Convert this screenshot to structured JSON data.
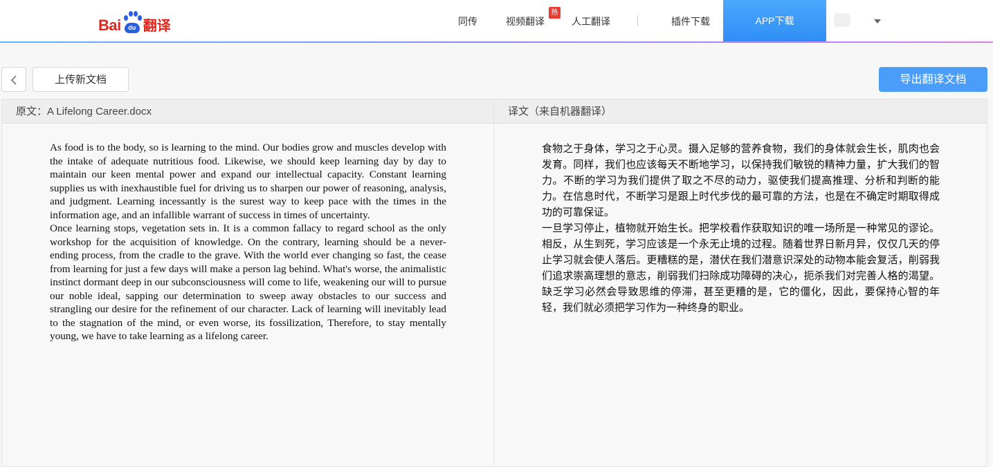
{
  "header": {
    "logo": {
      "bai": "Bai",
      "du": "du",
      "fanyi": "翻译"
    },
    "nav": [
      {
        "label": "同传"
      },
      {
        "label": "视频翻译",
        "badge": "热"
      },
      {
        "label": "人工翻译"
      },
      {
        "label": "插件下载"
      }
    ],
    "app_download": "APP下载"
  },
  "toolbar": {
    "upload_label": "上传新文档",
    "export_label": "导出翻译文档"
  },
  "source_panel": {
    "header_prefix": "原文：",
    "file_name": "A Lifelong Career.docx",
    "paragraphs": [
      "As food is to the body, so is learning to the mind. Our bodies grow and muscles develop with the intake of adequate nutritious food. Likewise, we should keep learning day by day to maintain our keen mental power and expand our intellectual capacity. Constant learning supplies us with inexhaustible fuel for driving us to sharpen our power of reasoning, analysis, and judgment. Learning incessantly is the surest way to keep pace with the times in the information age, and an infallible warrant of success in times of uncertainty.",
      "Once learning stops, vegetation sets in. It is a common fallacy to regard school as the only workshop for the acquisition of knowledge. On the contrary, learning should be a never-ending process, from the cradle to the grave. With the world ever changing so fast, the cease from learning for just a few days will make a person lag behind. What's worse, the animalistic instinct dormant deep in our subconsciousness will come to life, weakening our will to pursue our noble ideal, sapping our determination to sweep away obstacles to our success and strangling our desire for the refinement of our character. Lack of learning will inevitably lead to the stagnation of the mind, or even worse, its fossilization, Therefore, to stay mentally young, we have to take learning as a lifelong career."
    ]
  },
  "target_panel": {
    "header": "译文（来自机器翻译）",
    "paragraphs": [
      "食物之于身体，学习之于心灵。摄入足够的营养食物，我们的身体就会生长，肌肉也会发育。同样，我们也应该每天不断地学习，以保持我们敏锐的精神力量，扩大我们的智力。不断的学习为我们提供了取之不尽的动力，驱使我们提高推理、分析和判断的能力。在信息时代，不断学习是跟上时代步伐的最可靠的方法，也是在不确定时期取得成功的可靠保证。",
      "一旦学习停止，植物就开始生长。把学校看作获取知识的唯一场所是一种常见的谬论。相反，从生到死，学习应该是一个永无止境的过程。随着世界日新月异，仅仅几天的停止学习就会使人落后。更糟糕的是，潜伏在我们潜意识深处的动物本能会复活，削弱我们追求崇高理想的意志，削弱我们扫除成功障碍的决心，扼杀我们对完善人格的渴望。缺乏学习必然会导致思维的停滞，甚至更糟的是，它的僵化，因此，要保持心智的年轻，我们就必须把学习作为一种终身的职业。"
    ]
  },
  "colors": {
    "brand_red": "#e1251b",
    "brand_blue": "#2b5fe3",
    "app_button": "#3a99f8",
    "export_button": "#4a9df8",
    "hot_badge": "#e73b34"
  }
}
